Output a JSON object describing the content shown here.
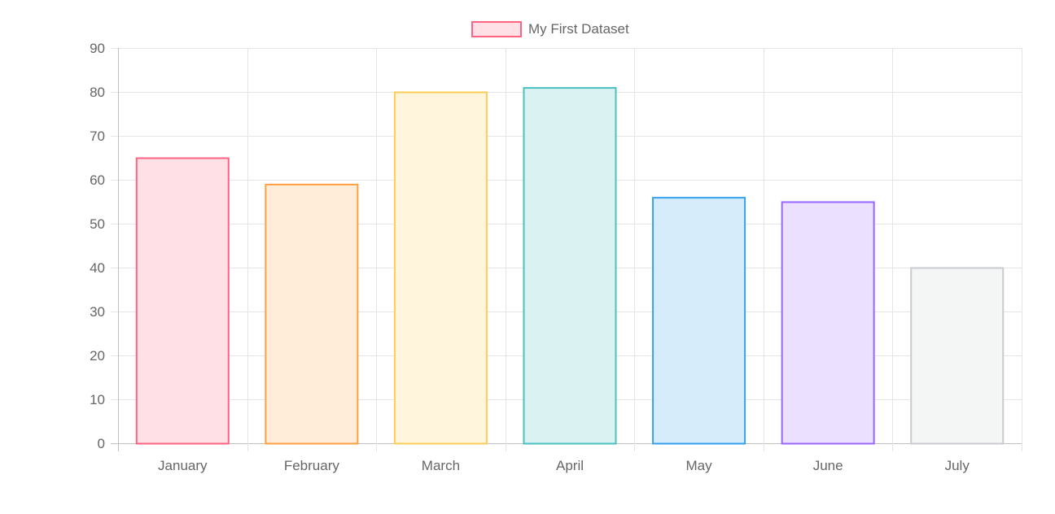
{
  "chart_data": {
    "type": "bar",
    "categories": [
      "January",
      "February",
      "March",
      "April",
      "May",
      "June",
      "July"
    ],
    "series": [
      {
        "name": "My First Dataset",
        "values": [
          65,
          59,
          80,
          81,
          56,
          55,
          40
        ],
        "legend_fill": "#ffe0e6",
        "legend_stroke": "#ff6384",
        "fills": [
          "#ffe0e6",
          "#ffecd9",
          "#fff5dd",
          "#dbf2f2",
          "#d7ecfb",
          "#ebe0ff",
          "#f4f5f5"
        ],
        "strokes": [
          "#ff6384",
          "#ff9f40",
          "#ffcd56",
          "#4bc0c0",
          "#36a2eb",
          "#9966ff",
          "#c9cbcf"
        ]
      }
    ],
    "ylim": [
      0,
      90
    ],
    "yticks": [
      0,
      10,
      20,
      30,
      40,
      50,
      60,
      70,
      80,
      90
    ],
    "grid": true,
    "legend_position": "top"
  }
}
